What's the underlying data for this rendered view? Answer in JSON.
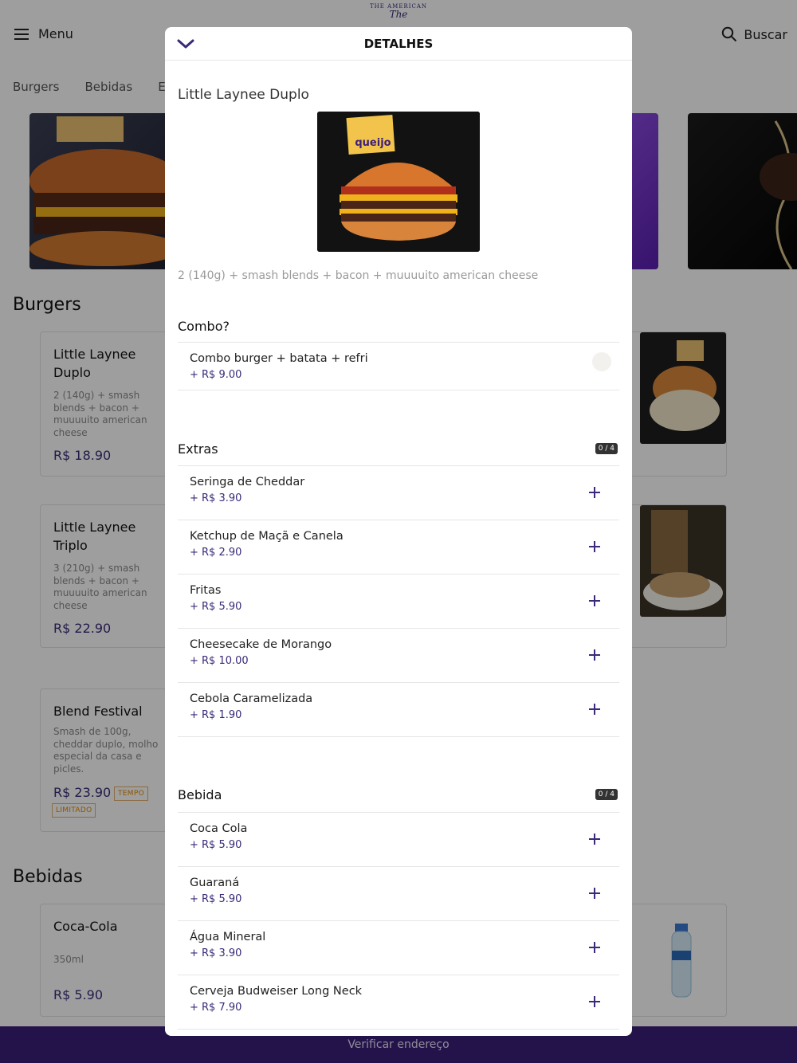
{
  "topbar": {
    "menu_label": "Menu",
    "search_label": "Buscar",
    "logo_arc": "THE AMERICAN",
    "logo_script": "The"
  },
  "categories": [
    "Burgers",
    "Bebidas",
    "Ex"
  ],
  "sections": {
    "burgers_title": "Burgers",
    "bebidas_title": "Bebidas"
  },
  "products": [
    {
      "name": "Little Laynee Duplo",
      "desc": "2 (140g) + smash blends + bacon + muuuuito american cheese",
      "price": "R$ 18.90"
    },
    {
      "name": "Little Laynee Triplo",
      "desc": "3 (210g) + smash blends + bacon + muuuuito american cheese",
      "price": "R$ 22.90"
    },
    {
      "name": "Blend Festival",
      "desc": "Smash de 100g, cheddar duplo, molho especial da casa e picles.",
      "price": "R$ 23.90",
      "badge": "TEMPO LIMITADO"
    },
    {
      "name": "Coca-Cola",
      "desc": "350ml",
      "price": "R$ 5.90"
    }
  ],
  "address_bar": "Verificar endereço",
  "modal": {
    "header_title": "DETALHES",
    "product_title": "Little Laynee Duplo",
    "image_label": "queijo",
    "product_desc": "2 (140g) + smash blends + bacon + muuuuito american cheese",
    "combo": {
      "title": "Combo?",
      "options": [
        {
          "name": "Combo burger + batata + refri",
          "price": "+ R$ 9.00"
        }
      ]
    },
    "extras": {
      "title": "Extras",
      "count": "0 / 4",
      "options": [
        {
          "name": "Seringa de Cheddar",
          "price": "+ R$ 3.90"
        },
        {
          "name": "Ketchup de Maçã e Canela",
          "price": "+ R$ 2.90"
        },
        {
          "name": "Fritas",
          "price": "+ R$ 5.90"
        },
        {
          "name": "Cheesecake de Morango",
          "price": "+ R$ 10.00"
        },
        {
          "name": "Cebola Caramelizada",
          "price": "+ R$ 1.90"
        }
      ]
    },
    "bebida": {
      "title": "Bebida",
      "count": "0 / 4",
      "options": [
        {
          "name": "Coca Cola",
          "price": "+ R$ 5.90"
        },
        {
          "name": "Guaraná",
          "price": "+ R$ 5.90"
        },
        {
          "name": "Água Mineral",
          "price": "+ R$ 3.90"
        },
        {
          "name": "Cerveja Budweiser Long Neck",
          "price": "+ R$ 7.90"
        }
      ]
    }
  },
  "colors": {
    "accent": "#3a2a78",
    "address_bar": "#3b1f7a",
    "badge_orange": "#e08a00"
  }
}
